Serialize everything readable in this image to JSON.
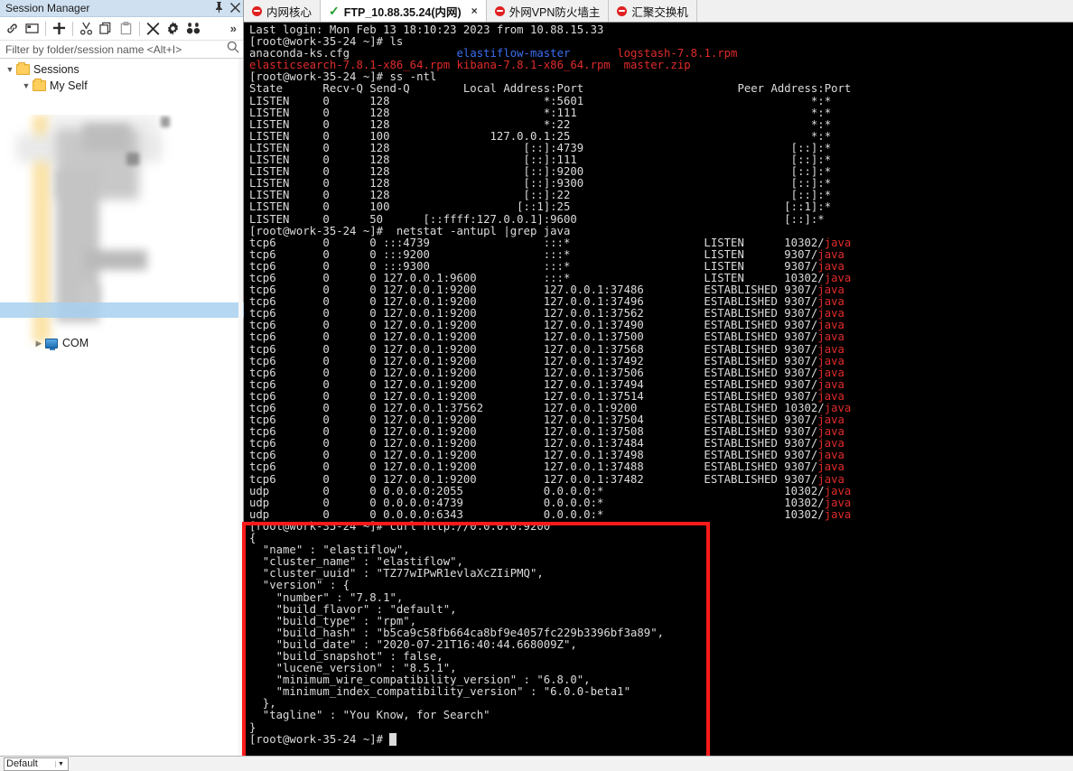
{
  "session_panel": {
    "title": "Session Manager",
    "pin_icon": "pin-icon",
    "close_icon": "close-icon",
    "toolbar": [
      {
        "name": "link-icon",
        "glyph": "⚭"
      },
      {
        "name": "new-folder-icon",
        "glyph": "☐"
      },
      {
        "name": "add-session-icon",
        "glyph": "＋"
      },
      {
        "name": "cut-icon",
        "glyph": "✂"
      },
      {
        "name": "copy-icon",
        "glyph": "⧉"
      },
      {
        "name": "paste-icon",
        "glyph": "✇"
      },
      {
        "name": "delete-icon",
        "glyph": "✖"
      },
      {
        "name": "settings-icon",
        "glyph": "⚙"
      },
      {
        "name": "find-icon",
        "glyph": "ͦͦ"
      }
    ],
    "overflow_label": "»",
    "filter": {
      "placeholder": "Filter by folder/session name <Alt+I>",
      "value": "",
      "search_icon": "search-icon"
    },
    "tree": [
      {
        "label": "Sessions",
        "type": "folder",
        "expanded": true,
        "indent": 0
      },
      {
        "label": "My Self",
        "type": "folder",
        "expanded": true,
        "indent": 1
      },
      {
        "label": "COM",
        "type": "monitor",
        "expanded": false,
        "indent": 1
      }
    ],
    "redacted_note": "session entries are blurred/redacted"
  },
  "tabs": [
    {
      "label": "内网核心",
      "icon": "disconnected-icon",
      "active": false,
      "closable": false
    },
    {
      "label": "FTP_10.88.35.24(内网)",
      "icon": "connected-icon",
      "active": true,
      "closable": true,
      "close_label": "×"
    },
    {
      "label": "外网VPN防火墙主",
      "icon": "disconnected-icon",
      "active": false,
      "closable": false
    },
    {
      "label": "汇聚交换机",
      "icon": "disconnected-icon",
      "active": false,
      "closable": false
    }
  ],
  "terminal": {
    "lines": [
      [
        {
          "t": "Last login: Mon Feb 13 18:10:23 2023 from 10.88.15.33",
          "c": "c-white"
        }
      ],
      [
        {
          "t": "[root@work-35-24 ~]# ls",
          "c": "c-white"
        }
      ],
      [
        {
          "t": "anaconda-ks.cfg                ",
          "c": "c-white"
        },
        {
          "t": "elastiflow-master",
          "c": "c-blue"
        },
        {
          "t": "       ",
          "c": "c-white"
        },
        {
          "t": "logstash-7.8.1.rpm",
          "c": "c-red"
        }
      ],
      [
        {
          "t": "elasticsearch-7.8.1-x86_64.rpm ",
          "c": "c-red"
        },
        {
          "t": "kibana-7.8.1-x86_64.rpm ",
          "c": "c-red"
        },
        {
          "t": " master.zip",
          "c": "c-red"
        }
      ],
      [
        {
          "t": "[root@work-35-24 ~]# ss -ntl",
          "c": "c-white"
        }
      ],
      [
        {
          "t": "State      Recv-Q Send-Q        Local Address:Port                       Peer Address:Port",
          "c": "c-white"
        }
      ],
      [
        {
          "t": "LISTEN     0      128                       *:5601                                  *:*",
          "c": "c-white"
        }
      ],
      [
        {
          "t": "LISTEN     0      128                       *:111                                   *:*",
          "c": "c-white"
        }
      ],
      [
        {
          "t": "LISTEN     0      128                       *:22                                    *:*",
          "c": "c-white"
        }
      ],
      [
        {
          "t": "LISTEN     0      100               127.0.0.1:25                                    *:*",
          "c": "c-white"
        }
      ],
      [
        {
          "t": "LISTEN     0      128                    [::]:4739                               [::]:*",
          "c": "c-white"
        }
      ],
      [
        {
          "t": "LISTEN     0      128                    [::]:111                                [::]:*",
          "c": "c-white"
        }
      ],
      [
        {
          "t": "LISTEN     0      128                    [::]:9200                               [::]:*",
          "c": "c-white"
        }
      ],
      [
        {
          "t": "LISTEN     0      128                    [::]:9300                               [::]:*",
          "c": "c-white"
        }
      ],
      [
        {
          "t": "LISTEN     0      128                    [::]:22                                 [::]:*",
          "c": "c-white"
        }
      ],
      [
        {
          "t": "LISTEN     0      100                   [::1]:25                                [::1]:*",
          "c": "c-white"
        }
      ],
      [
        {
          "t": "LISTEN     0      50      [::ffff:127.0.0.1]:9600                               [::]:*",
          "c": "c-white"
        }
      ],
      [
        {
          "t": "[root@work-35-24 ~]#  netstat -antupl |grep java",
          "c": "c-white"
        }
      ],
      [
        {
          "t": "tcp6       0      0 :::4739                 :::*                    LISTEN      10302/",
          "c": "c-white"
        },
        {
          "t": "java",
          "c": "c-red"
        }
      ],
      [
        {
          "t": "tcp6       0      0 :::9200                 :::*                    LISTEN      9307/",
          "c": "c-white"
        },
        {
          "t": "java",
          "c": "c-red"
        }
      ],
      [
        {
          "t": "tcp6       0      0 :::9300                 :::*                    LISTEN      9307/",
          "c": "c-white"
        },
        {
          "t": "java",
          "c": "c-red"
        }
      ],
      [
        {
          "t": "tcp6       0      0 127.0.0.1:9600          :::*                    LISTEN      10302/",
          "c": "c-white"
        },
        {
          "t": "java",
          "c": "c-red"
        }
      ],
      [
        {
          "t": "tcp6       0      0 127.0.0.1:9200          127.0.0.1:37486         ESTABLISHED 9307/",
          "c": "c-white"
        },
        {
          "t": "java",
          "c": "c-red"
        }
      ],
      [
        {
          "t": "tcp6       0      0 127.0.0.1:9200          127.0.0.1:37496         ESTABLISHED 9307/",
          "c": "c-white"
        },
        {
          "t": "java",
          "c": "c-red"
        }
      ],
      [
        {
          "t": "tcp6       0      0 127.0.0.1:9200          127.0.0.1:37562         ESTABLISHED 9307/",
          "c": "c-white"
        },
        {
          "t": "java",
          "c": "c-red"
        }
      ],
      [
        {
          "t": "tcp6       0      0 127.0.0.1:9200          127.0.0.1:37490         ESTABLISHED 9307/",
          "c": "c-white"
        },
        {
          "t": "java",
          "c": "c-red"
        }
      ],
      [
        {
          "t": "tcp6       0      0 127.0.0.1:9200          127.0.0.1:37500         ESTABLISHED 9307/",
          "c": "c-white"
        },
        {
          "t": "java",
          "c": "c-red"
        }
      ],
      [
        {
          "t": "tcp6       0      0 127.0.0.1:9200          127.0.0.1:37568         ESTABLISHED 9307/",
          "c": "c-white"
        },
        {
          "t": "java",
          "c": "c-red"
        }
      ],
      [
        {
          "t": "tcp6       0      0 127.0.0.1:9200          127.0.0.1:37492         ESTABLISHED 9307/",
          "c": "c-white"
        },
        {
          "t": "java",
          "c": "c-red"
        }
      ],
      [
        {
          "t": "tcp6       0      0 127.0.0.1:9200          127.0.0.1:37506         ESTABLISHED 9307/",
          "c": "c-white"
        },
        {
          "t": "java",
          "c": "c-red"
        }
      ],
      [
        {
          "t": "tcp6       0      0 127.0.0.1:9200          127.0.0.1:37494         ESTABLISHED 9307/",
          "c": "c-white"
        },
        {
          "t": "java",
          "c": "c-red"
        }
      ],
      [
        {
          "t": "tcp6       0      0 127.0.0.1:9200          127.0.0.1:37514         ESTABLISHED 9307/",
          "c": "c-white"
        },
        {
          "t": "java",
          "c": "c-red"
        }
      ],
      [
        {
          "t": "tcp6       0      0 127.0.0.1:37562         127.0.0.1:9200          ESTABLISHED 10302/",
          "c": "c-white"
        },
        {
          "t": "java",
          "c": "c-red"
        }
      ],
      [
        {
          "t": "tcp6       0      0 127.0.0.1:9200          127.0.0.1:37504         ESTABLISHED 9307/",
          "c": "c-white"
        },
        {
          "t": "java",
          "c": "c-red"
        }
      ],
      [
        {
          "t": "tcp6       0      0 127.0.0.1:9200          127.0.0.1:37508         ESTABLISHED 9307/",
          "c": "c-white"
        },
        {
          "t": "java",
          "c": "c-red"
        }
      ],
      [
        {
          "t": "tcp6       0      0 127.0.0.1:9200          127.0.0.1:37484         ESTABLISHED 9307/",
          "c": "c-white"
        },
        {
          "t": "java",
          "c": "c-red"
        }
      ],
      [
        {
          "t": "tcp6       0      0 127.0.0.1:9200          127.0.0.1:37498         ESTABLISHED 9307/",
          "c": "c-white"
        },
        {
          "t": "java",
          "c": "c-red"
        }
      ],
      [
        {
          "t": "tcp6       0      0 127.0.0.1:9200          127.0.0.1:37488         ESTABLISHED 9307/",
          "c": "c-white"
        },
        {
          "t": "java",
          "c": "c-red"
        }
      ],
      [
        {
          "t": "tcp6       0      0 127.0.0.1:9200          127.0.0.1:37482         ESTABLISHED 9307/",
          "c": "c-white"
        },
        {
          "t": "java",
          "c": "c-red"
        }
      ],
      [
        {
          "t": "udp        0      0 0.0.0.0:2055            0.0.0.0:*                           10302/",
          "c": "c-white"
        },
        {
          "t": "java",
          "c": "c-red"
        }
      ],
      [
        {
          "t": "udp        0      0 0.0.0.0:4739            0.0.0.0:*                           10302/",
          "c": "c-white"
        },
        {
          "t": "java",
          "c": "c-red"
        }
      ],
      [
        {
          "t": "udp        0      0 0.0.0.0:6343            0.0.0.0:*                           10302/",
          "c": "c-white"
        },
        {
          "t": "java",
          "c": "c-red"
        }
      ],
      [
        {
          "t": "[root@work-35-24 ~]# curl http://0.0.0.0:9200",
          "c": "c-white"
        }
      ],
      [
        {
          "t": "{",
          "c": "c-white"
        }
      ],
      [
        {
          "t": "  \"name\" : \"elastiflow\",",
          "c": "c-white"
        }
      ],
      [
        {
          "t": "  \"cluster_name\" : \"elastiflow\",",
          "c": "c-white"
        }
      ],
      [
        {
          "t": "  \"cluster_uuid\" : \"TZ77wIPwR1evlaXcZIiPMQ\",",
          "c": "c-white"
        }
      ],
      [
        {
          "t": "  \"version\" : {",
          "c": "c-white"
        }
      ],
      [
        {
          "t": "    \"number\" : \"7.8.1\",",
          "c": "c-white"
        }
      ],
      [
        {
          "t": "    \"build_flavor\" : \"default\",",
          "c": "c-white"
        }
      ],
      [
        {
          "t": "    \"build_type\" : \"rpm\",",
          "c": "c-white"
        }
      ],
      [
        {
          "t": "    \"build_hash\" : \"b5ca9c58fb664ca8bf9e4057fc229b3396bf3a89\",",
          "c": "c-white"
        }
      ],
      [
        {
          "t": "    \"build_date\" : \"2020-07-21T16:40:44.668009Z\",",
          "c": "c-white"
        }
      ],
      [
        {
          "t": "    \"build_snapshot\" : false,",
          "c": "c-white"
        }
      ],
      [
        {
          "t": "    \"lucene_version\" : \"8.5.1\",",
          "c": "c-white"
        }
      ],
      [
        {
          "t": "    \"minimum_wire_compatibility_version\" : \"6.8.0\",",
          "c": "c-white"
        }
      ],
      [
        {
          "t": "    \"minimum_index_compatibility_version\" : \"6.0.0-beta1\"",
          "c": "c-white"
        }
      ],
      [
        {
          "t": "  },",
          "c": "c-white"
        }
      ],
      [
        {
          "t": "  \"tagline\" : \"You Know, for Search\"",
          "c": "c-white"
        }
      ],
      [
        {
          "t": "}",
          "c": "c-white"
        }
      ],
      [
        {
          "t": "[root@work-35-24 ~]# ",
          "c": "c-white"
        }
      ]
    ]
  },
  "annotation": {
    "shape": "rectangle",
    "color": "#ff1a1a",
    "target": "curl http://0.0.0.0:9200 response block"
  },
  "statusbar": {
    "profile": "Default",
    "arrow": "▼"
  },
  "colors": {
    "accent": "#cfe0f0",
    "terminal_bg": "#000000",
    "terminal_fg": "#dcdcdc",
    "red": "#e02b2b",
    "blue": "#3b6ff2",
    "annotation_red": "#ff1a1a",
    "selection": "#a8d0ef"
  }
}
